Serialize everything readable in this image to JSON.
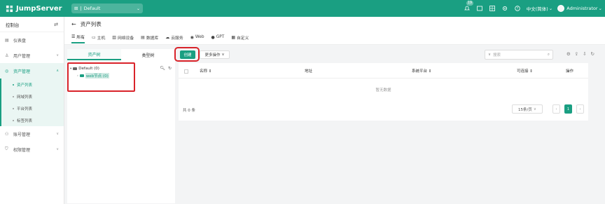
{
  "topbar": {
    "brand": "JumpServer",
    "org": "Default",
    "notif_count": "19",
    "language": "中文(简体)",
    "user": "Administrator"
  },
  "sidebar": {
    "title": "控制台",
    "items": [
      {
        "label": "仪表盘",
        "icon": "dashboard-icon"
      },
      {
        "label": "用户管理",
        "icon": "users-icon"
      },
      {
        "label": "资产管理",
        "icon": "assets-icon"
      },
      {
        "label": "账号管理",
        "icon": "accounts-icon"
      },
      {
        "label": "权限管理",
        "icon": "permissions-icon"
      }
    ],
    "subitems": [
      "资产列表",
      "网域列表",
      "平台列表",
      "标签列表"
    ]
  },
  "header": {
    "title": "资产列表",
    "tabs": [
      "所有",
      "主机",
      "网络设备",
      "数据库",
      "云服务",
      "Web",
      "GPT",
      "自定义"
    ]
  },
  "tree": {
    "tabs": [
      "资产树",
      "类型树"
    ],
    "root": "Default (0)",
    "child": "web节点 (0)"
  },
  "toolbar": {
    "create": "创建",
    "more": "更多操作",
    "search_placeholder": "搜索"
  },
  "table": {
    "columns": [
      "名称",
      "地址",
      "系统平台",
      "可连接",
      "操作"
    ],
    "empty": "暂无数据",
    "total": "共 0 条",
    "page_size": "15条/页",
    "page": "1"
  },
  "colors": {
    "brand": "#1a9f82",
    "highlight_box": "#d9232a"
  }
}
